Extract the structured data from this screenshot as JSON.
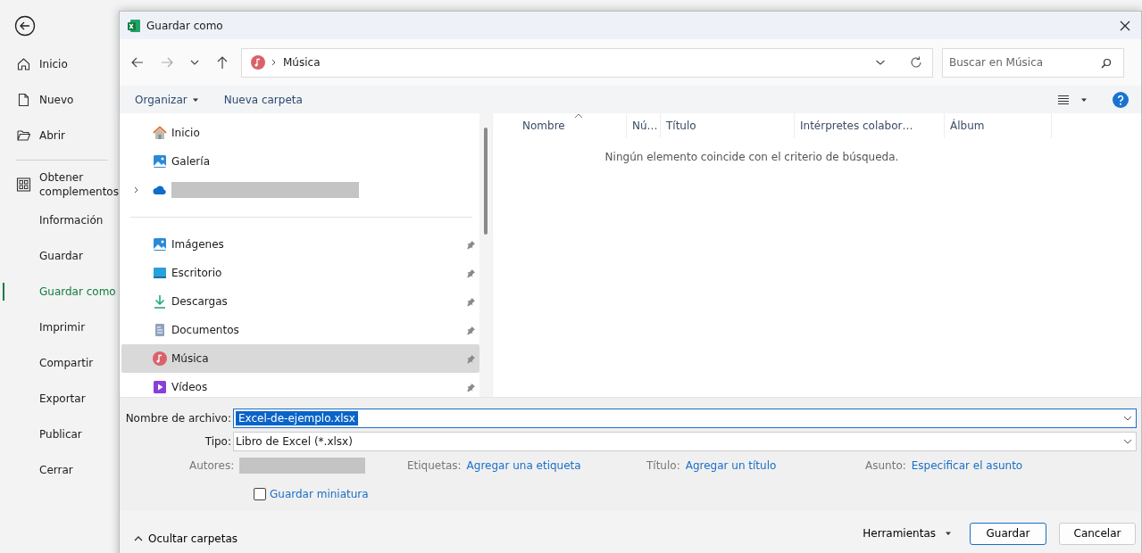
{
  "backstage": {
    "items": [
      {
        "label": "Inicio",
        "selected": false
      },
      {
        "label": "Nuevo",
        "selected": false
      },
      {
        "label": "Abrir",
        "selected": false
      },
      {
        "label": "Obtener complementos",
        "selected": false
      },
      {
        "label": "Información",
        "selected": false
      },
      {
        "label": "Guardar",
        "selected": false
      },
      {
        "label": "Guardar como",
        "selected": true
      },
      {
        "label": "Imprimir",
        "selected": false
      },
      {
        "label": "Compartir",
        "selected": false
      },
      {
        "label": "Exportar",
        "selected": false
      },
      {
        "label": "Publicar",
        "selected": false
      },
      {
        "label": "Cerrar",
        "selected": false
      }
    ]
  },
  "dialog": {
    "title": "Guardar como",
    "address": {
      "location": "Música"
    },
    "search": {
      "placeholder": "Buscar en Música"
    },
    "toolbar": {
      "organize": "Organizar",
      "new_folder": "Nueva carpeta"
    },
    "nav_pane": {
      "items": [
        {
          "label": "Inicio",
          "pinned": false,
          "selected": false
        },
        {
          "label": "Galería",
          "pinned": false,
          "selected": false
        },
        {
          "kind": "redacted",
          "pinned": false,
          "selected": false,
          "expanded": false
        },
        {
          "label": "Imágenes",
          "pinned": true,
          "selected": false
        },
        {
          "label": "Escritorio",
          "pinned": true,
          "selected": false
        },
        {
          "label": "Descargas",
          "pinned": true,
          "selected": false
        },
        {
          "label": "Documentos",
          "pinned": true,
          "selected": false
        },
        {
          "label": "Música",
          "pinned": true,
          "selected": true
        },
        {
          "label": "Vídeos",
          "pinned": true,
          "selected": false
        }
      ]
    },
    "columns": [
      "Nombre",
      "Nú…",
      "Título",
      "Intérpretes colabor…",
      "Álbum"
    ],
    "empty_message": "Ningún elemento coincide con el criterio de búsqueda.",
    "file_name": {
      "label": "Nombre de archivo:",
      "value": "Excel-de-ejemplo.xlsx"
    },
    "file_type": {
      "label": "Tipo:",
      "value": "Libro de Excel (*.xlsx)"
    },
    "metadata": [
      {
        "label": "Autores:",
        "kind": "redacted"
      },
      {
        "label": "Etiquetas:",
        "kind": "link",
        "value": "Agregar una etiqueta"
      },
      {
        "label": "Título:",
        "kind": "link",
        "value": "Agregar un título"
      },
      {
        "label": "Asunto:",
        "kind": "link",
        "value": "Especificar el asunto"
      }
    ],
    "thumbnail": {
      "label": "Guardar miniatura",
      "checked": false
    },
    "hide_folders": "Ocultar carpetas",
    "tools": "Herramientas",
    "buttons": [
      "Guardar",
      "Cancelar"
    ]
  }
}
